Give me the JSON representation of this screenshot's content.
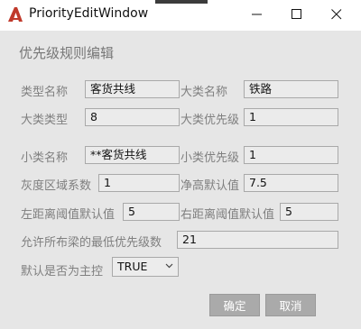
{
  "window": {
    "title": "PriorityEditWindow",
    "heading": "优先级规则编辑"
  },
  "form": {
    "type_name": {
      "label": "类型名称",
      "value": "客货共线"
    },
    "major_name": {
      "label": "大类名称",
      "value": "铁路"
    },
    "major_type": {
      "label": "大类类型",
      "value": "8"
    },
    "major_priority": {
      "label": "大类优先级",
      "value": "1"
    },
    "minor_name": {
      "label": "小类名称",
      "value": "**客货共线"
    },
    "minor_priority": {
      "label": "小类优先级",
      "value": "1"
    },
    "gray_coefficient": {
      "label": "灰度区域系数",
      "value": "1"
    },
    "clearance_default": {
      "label": "净高默认值",
      "value": "7.5"
    },
    "left_threshold": {
      "label": "左距离阈值默认值",
      "value": "5"
    },
    "right_threshold": {
      "label": "右距离阈值默认值",
      "value": "5"
    },
    "min_priority": {
      "label": "允许所布梁的最低优先级数",
      "value": "21"
    },
    "is_main_control": {
      "label": "默认是否为主控",
      "value": "TRUE"
    }
  },
  "buttons": {
    "ok": "确定",
    "cancel": "取消"
  },
  "colors": {
    "accent_icon": "#c0392b",
    "button_bg": "#aaaaaa",
    "label": "#7f7f7f"
  }
}
